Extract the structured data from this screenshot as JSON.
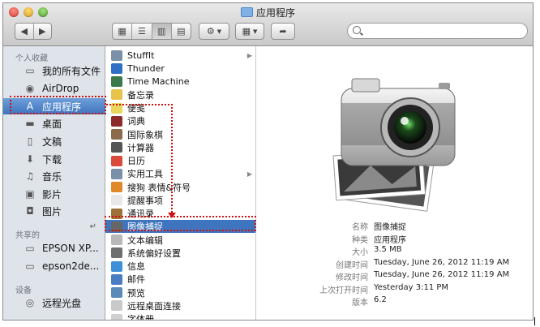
{
  "window": {
    "title": "应用程序"
  },
  "sidebar": {
    "sections": {
      "favorites": "个人收藏",
      "shared": "共享的",
      "devices": "设备"
    },
    "favorites": [
      {
        "label": "我的所有文件",
        "icon": "all-files-icon"
      },
      {
        "label": "AirDrop",
        "icon": "airdrop-icon"
      },
      {
        "label": "应用程序",
        "icon": "applications-icon",
        "selected": true
      },
      {
        "label": "桌面",
        "icon": "desktop-icon"
      },
      {
        "label": "文稿",
        "icon": "documents-icon"
      },
      {
        "label": "下载",
        "icon": "downloads-icon"
      },
      {
        "label": "音乐",
        "icon": "music-icon"
      },
      {
        "label": "影片",
        "icon": "movies-icon"
      },
      {
        "label": "图片",
        "icon": "pictures-icon"
      }
    ],
    "shared": [
      {
        "label": "EPSON XP...",
        "icon": "printer-icon"
      },
      {
        "label": "epson2de...",
        "icon": "computer-icon"
      }
    ],
    "devices": [
      {
        "label": "远程光盘",
        "icon": "disc-icon"
      }
    ]
  },
  "apps": [
    {
      "label": "StuffIt",
      "color": "#7a8fa8",
      "folder": true
    },
    {
      "label": "Thunder",
      "color": "#2f6fc4"
    },
    {
      "label": "Time Machine",
      "color": "#3a7a4a"
    },
    {
      "label": "备忘录",
      "color": "#e7c34a"
    },
    {
      "label": "便笺",
      "color": "#e9d65a"
    },
    {
      "label": "词典",
      "color": "#8b2b2b"
    },
    {
      "label": "国际象棋",
      "color": "#8a6a4a"
    },
    {
      "label": "计算器",
      "color": "#555555"
    },
    {
      "label": "日历",
      "color": "#d94a3a"
    },
    {
      "label": "实用工具",
      "color": "#7a8fa8",
      "folder": true
    },
    {
      "label": "搜狗 表情&符号",
      "color": "#e0882a"
    },
    {
      "label": "提醒事项",
      "color": "#e8e8e8"
    },
    {
      "label": "通讯录",
      "color": "#a0703a"
    },
    {
      "label": "图像捕捉",
      "color": "#666666",
      "selected": true
    },
    {
      "label": "文本编辑",
      "color": "#b9b9b9"
    },
    {
      "label": "系统偏好设置",
      "color": "#6f6f6f"
    },
    {
      "label": "信息",
      "color": "#3d8fd8"
    },
    {
      "label": "邮件",
      "color": "#4a7cc4"
    },
    {
      "label": "预览",
      "color": "#5a8ab8"
    },
    {
      "label": "远程桌面连接",
      "color": "#c9c9c9"
    },
    {
      "label": "字体册",
      "color": "#d0d0d0"
    }
  ],
  "preview": {
    "info": [
      {
        "key": "名称",
        "value": "图像捕捉"
      },
      {
        "key": "种类",
        "value": "应用程序"
      },
      {
        "key": "大小",
        "value": "3.5 MB"
      },
      {
        "key": "创建时间",
        "value": "Tuesday, June 26, 2012 11:19 AM"
      },
      {
        "key": "修改时间",
        "value": "Tuesday, June 26, 2012 11:19 AM"
      },
      {
        "key": "上次打开时间",
        "value": "Yesterday 3:11 PM"
      },
      {
        "key": "版本",
        "value": "6.2"
      }
    ]
  },
  "colors": {
    "selection": "#3f74be",
    "annotation": "#d01010",
    "sidebar_bg": "#dfe4ea"
  }
}
